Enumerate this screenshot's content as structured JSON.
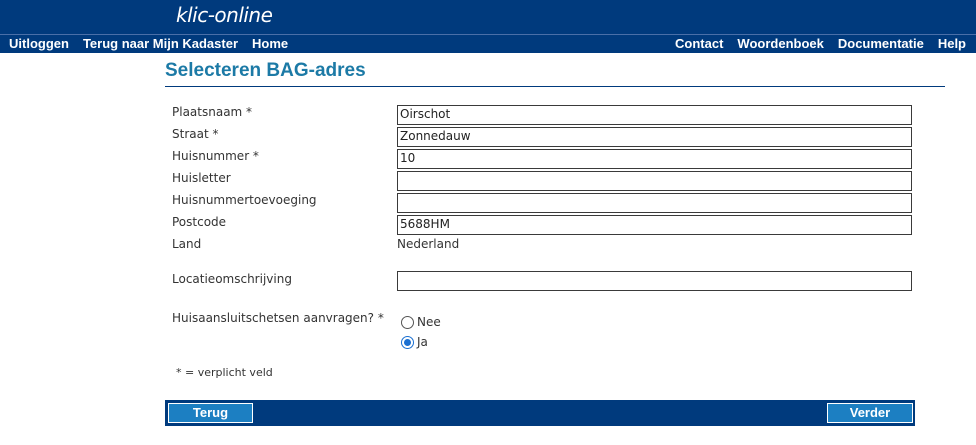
{
  "app": {
    "logo": "klic-online"
  },
  "nav": {
    "left": [
      "Uitloggen",
      "Terug naar Mijn Kadaster",
      "Home"
    ],
    "right": [
      "Contact",
      "Woordenboek",
      "Documentatie",
      "Help"
    ]
  },
  "page": {
    "title": "Selecteren BAG-adres"
  },
  "form": {
    "plaatsnaam": {
      "label": "Plaatsnaam *",
      "value": "Oirschot"
    },
    "straat": {
      "label": "Straat *",
      "value": "Zonnedauw"
    },
    "huisnummer": {
      "label": "Huisnummer *",
      "value": "10"
    },
    "huisletter": {
      "label": "Huisletter",
      "value": ""
    },
    "toevoeging": {
      "label": "Huisnummertoevoeging",
      "value": ""
    },
    "postcode": {
      "label": "Postcode",
      "value": "5688HM"
    },
    "land": {
      "label": "Land",
      "value": "Nederland"
    },
    "locatie": {
      "label": "Locatieomschrijving",
      "value": ""
    },
    "huisaansluiting": {
      "label": "Huisaansluitschetsen aanvragen? *",
      "options": [
        "Nee",
        "Ja"
      ],
      "selected": "Ja"
    },
    "footnote": "* = verplicht veld"
  },
  "actions": {
    "back": "Terug",
    "next": "Verder"
  },
  "colors": {
    "brand_navy": "#003a7d",
    "title_blue": "#1c7aa6",
    "button_blue": "#1c7fc2"
  }
}
